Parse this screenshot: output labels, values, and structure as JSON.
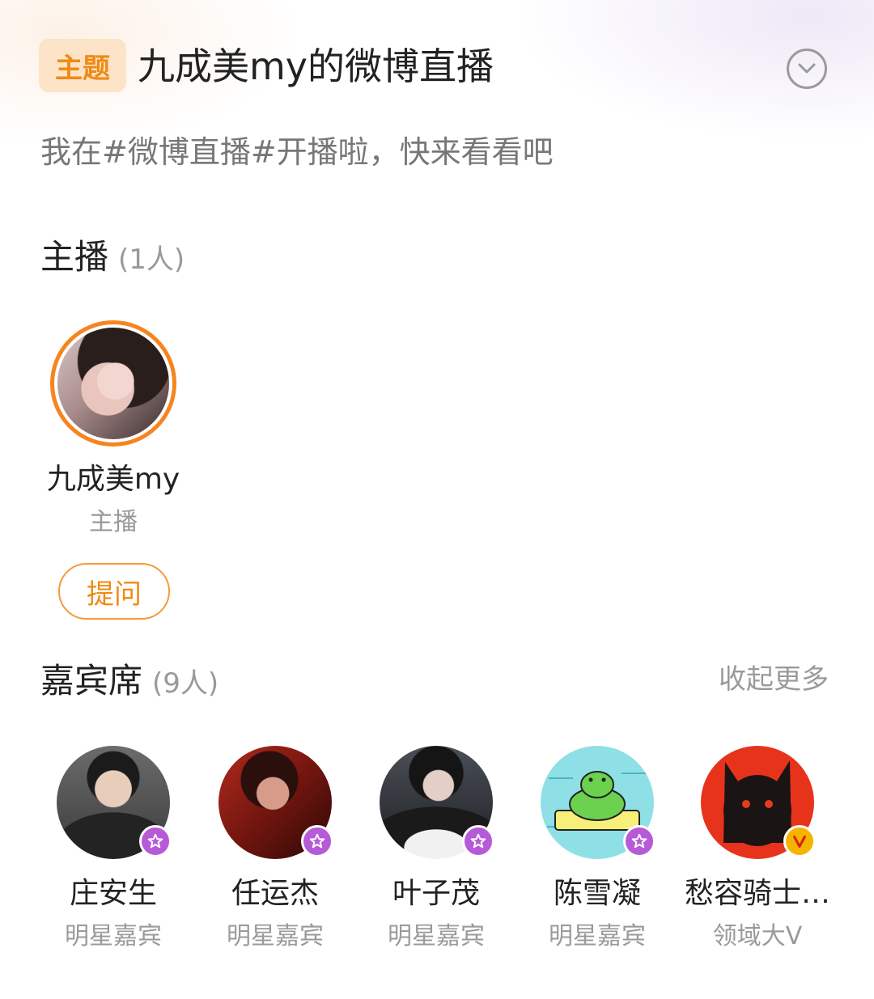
{
  "header": {
    "tag_label": "主题",
    "title": "九成美my的微博直播",
    "description": "我在#微博直播#开播啦，快来看看吧"
  },
  "host_section": {
    "title": "主播",
    "count": "(1人)",
    "host": {
      "name": "九成美my",
      "role": "主播"
    },
    "ask_label": "提问"
  },
  "guest_section": {
    "title": "嘉宾席",
    "count": "(9人)",
    "collapse_label": "收起更多",
    "guests": [
      {
        "name": "庄安生",
        "role": "明星嘉宾",
        "badge": "star-icon"
      },
      {
        "name": "任运杰",
        "role": "明星嘉宾",
        "badge": "star-icon"
      },
      {
        "name": "叶子茂",
        "role": "明星嘉宾",
        "badge": "star-icon"
      },
      {
        "name": "陈雪凝",
        "role": "明星嘉宾",
        "badge": "star-icon"
      },
      {
        "name": "愁容骑士…",
        "role": "领域大V",
        "badge": "v-badge-icon"
      }
    ]
  },
  "colors": {
    "accent_orange": "#f08a15",
    "tag_bg": "#fde3c8",
    "star_badge": "#b65ad8",
    "v_badge": "#f5b400"
  }
}
